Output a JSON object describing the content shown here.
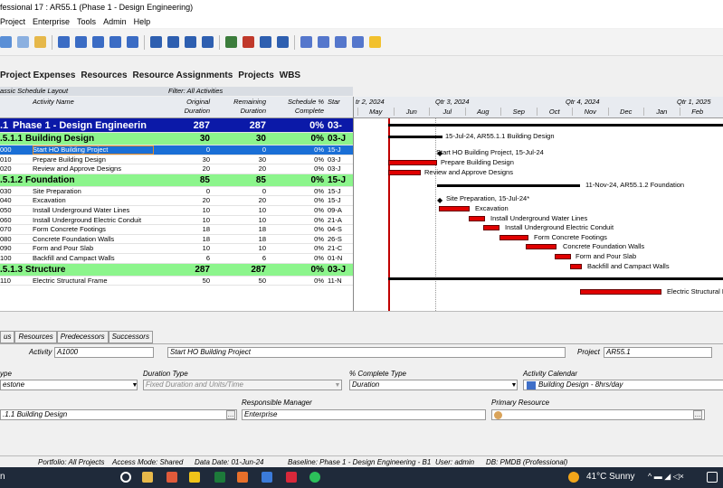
{
  "window": {
    "title": "fessional 17 : AR55.1 (Phase 1 - Design Engineering)"
  },
  "menu": [
    "Project",
    "Enterprise",
    "Tools",
    "Admin",
    "Help"
  ],
  "tabs": [
    "Project Expenses",
    "Resources",
    "Resource Assignments",
    "Projects",
    "WBS"
  ],
  "layout": {
    "name": "assic Schedule Layout",
    "filter": "Filter: All Activities"
  },
  "columns": {
    "activity_name": "Activity Name",
    "orig1": "Original",
    "orig2": "Duration",
    "rem1": "Remaining",
    "rem2": "Duration",
    "sched1": "Schedule %",
    "sched2": "Complete",
    "start": "Star"
  },
  "rows": [
    {
      "id": ".1",
      "name": "Phase 1 - Design Engineerin",
      "od": "287",
      "rd": "287",
      "pc": "0%",
      "st": "03-",
      "kind": "wbs1"
    },
    {
      "id": ".5.1.1",
      "name": "Building Design",
      "od": "30",
      "rd": "30",
      "pc": "0%",
      "st": "03-J",
      "kind": "wbs2"
    },
    {
      "id": "000",
      "name": "Start HO Building Project",
      "od": "0",
      "rd": "0",
      "pc": "0%",
      "st": "15-J",
      "kind": "sel"
    },
    {
      "id": "010",
      "name": "Prepare Building Design",
      "od": "30",
      "rd": "30",
      "pc": "0%",
      "st": "03-J",
      "kind": "act"
    },
    {
      "id": "020",
      "name": "Review and Approve Designs",
      "od": "20",
      "rd": "20",
      "pc": "0%",
      "st": "03-J",
      "kind": "act"
    },
    {
      "id": ".5.1.2",
      "name": "Foundation",
      "od": "85",
      "rd": "85",
      "pc": "0%",
      "st": "15-J",
      "kind": "wbs2"
    },
    {
      "id": "030",
      "name": "Site Preparation",
      "od": "0",
      "rd": "0",
      "pc": "0%",
      "st": "15-J",
      "kind": "act"
    },
    {
      "id": "040",
      "name": "Excavation",
      "od": "20",
      "rd": "20",
      "pc": "0%",
      "st": "15-J",
      "kind": "act"
    },
    {
      "id": "050",
      "name": "Install Underground Water Lines",
      "od": "10",
      "rd": "10",
      "pc": "0%",
      "st": "09-A",
      "kind": "act"
    },
    {
      "id": "060",
      "name": "Install Underground Electric Conduit",
      "od": "10",
      "rd": "10",
      "pc": "0%",
      "st": "21-A",
      "kind": "act"
    },
    {
      "id": "070",
      "name": "Form Concrete Footings",
      "od": "18",
      "rd": "18",
      "pc": "0%",
      "st": "04-S",
      "kind": "act"
    },
    {
      "id": "080",
      "name": "Concrete Foundation Walls",
      "od": "18",
      "rd": "18",
      "pc": "0%",
      "st": "26-S",
      "kind": "act"
    },
    {
      "id": "090",
      "name": "Form and Pour Slab",
      "od": "10",
      "rd": "10",
      "pc": "0%",
      "st": "21-C",
      "kind": "act"
    },
    {
      "id": "100",
      "name": "Backfill and Campact Walls",
      "od": "6",
      "rd": "6",
      "pc": "0%",
      "st": "01-N",
      "kind": "act"
    },
    {
      "id": ".5.1.3",
      "name": "Structure",
      "od": "287",
      "rd": "287",
      "pc": "0%",
      "st": "03-J",
      "kind": "wbs2"
    },
    {
      "id": "110",
      "name": "Electric Structural Frame",
      "od": "50",
      "rd": "50",
      "pc": "0%",
      "st": "11-N",
      "kind": "act"
    }
  ],
  "gantt": {
    "quarters": [
      "tr 2, 2024",
      "Qtr 3, 2024",
      "Qtr 4, 2024",
      "Qtr 1, 2025"
    ],
    "months": [
      "May",
      "Jun",
      "Jul",
      "Aug",
      "Sep",
      "Oct",
      "Nov",
      "Dec",
      "Jan",
      "Feb"
    ],
    "labels": {
      "bd": "15-Jul-24, AR55.1.1  Building Design",
      "start": "Start HO Building Project, 15-Jul-24",
      "prep": "Prepare Building Design",
      "review": "Review and Approve Designs",
      "found": "11-Nov-24, AR55.1.2  Foundation",
      "site": "Site Preparation, 15-Jul-24*",
      "exc": "Excavation",
      "water": "Install Underground Water Lines",
      "elec": "Install Underground Electric Conduit",
      "foot": "Form Concrete Footings",
      "walls": "Concrete Foundation Walls",
      "slab": "Form and Pour Slab",
      "back": "Backfill and Campact Walls",
      "frame": "Electric Structural F"
    }
  },
  "bottom_tabs": [
    "us",
    "Resources",
    "Predecessors",
    "Successors"
  ],
  "detail": {
    "activity_label": "Activity",
    "activity_value": "A1000",
    "activity_name": "Start HO Building Project",
    "project_label": "Project",
    "project_value": "AR55.1",
    "type_label": "ype",
    "type_value": "estone",
    "dur_type_label": "Duration Type",
    "dur_type_value": "Fixed Duration and Units/Time",
    "pct_type_label": "% Complete Type",
    "pct_type_value": "Duration",
    "cal_label": "Activity Calendar",
    "cal_value": "Building Design - 8hrs/day",
    "resp_label": "Responsible Manager",
    "resp_value": "Enterprise",
    "wbs_value": ".1.1  Building Design",
    "primres_label": "Primary Resource"
  },
  "status": {
    "portfolio": "Portfolio: All Projects",
    "access": "Access Mode: Shared",
    "data_date": "Data Date: 01-Jun-24",
    "baseline": "Baseline: Phase 1 - Design Engineering - B1",
    "user": "User: admin",
    "db": "DB: PMDB (Professional)"
  },
  "taskbar": {
    "left": "n",
    "weather": "41°C  Sunny"
  }
}
